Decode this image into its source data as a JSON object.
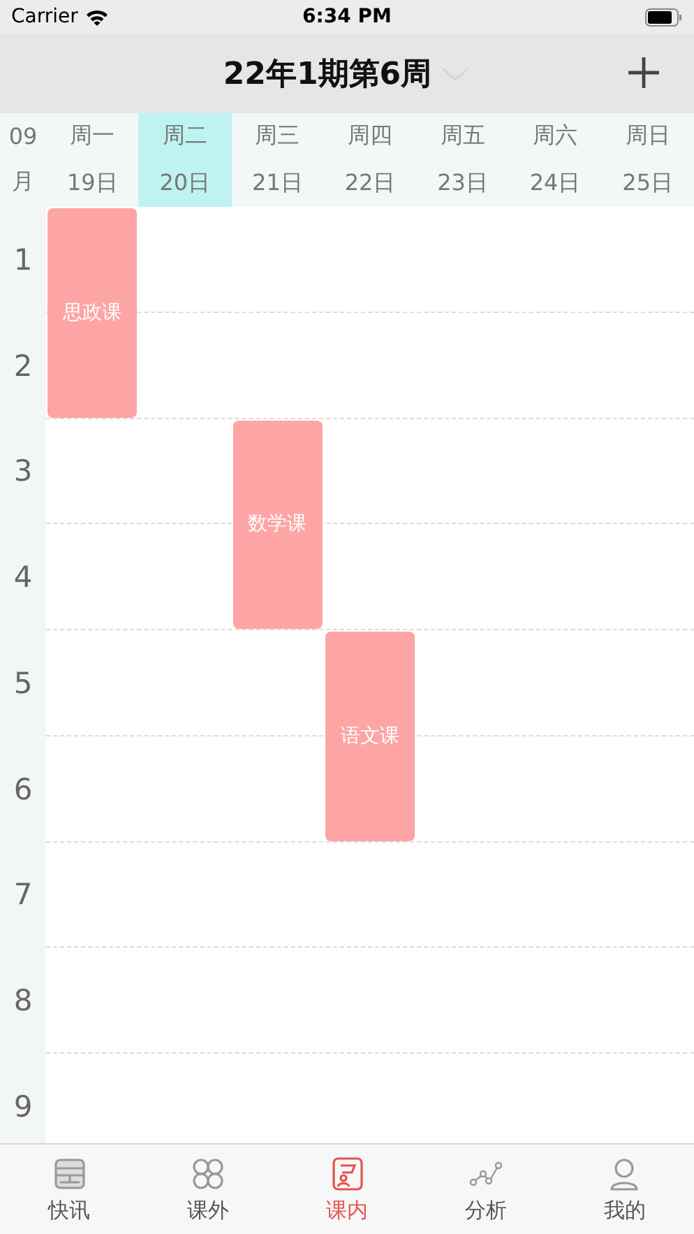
{
  "status_bar": {
    "carrier": "Carrier",
    "time": "6:34 PM"
  },
  "header": {
    "title": "22年1期第6周",
    "dropdown": true
  },
  "month": {
    "number": "09",
    "unit": "月"
  },
  "days": [
    {
      "weekday": "周一",
      "date": "19日",
      "selected": false,
      "sessions": [
        {
          "kind": "course",
          "name": "思政课"
        }
      ]
    },
    {
      "weekday": "周二",
      "date": "20日",
      "selected": true
    },
    {
      "weekday": "周三",
      "date": "21日",
      "selected": false,
      "sessions": [
        {
          "kind": "gap"
        },
        {
          "kind": "gap"
        },
        {
          "kind": "course",
          "name": "数学课"
        }
      ]
    },
    {
      "weekday": "周四",
      "date": "22日",
      "selected": false,
      "sessions": [
        {
          "kind": "gap"
        },
        {
          "kind": "gap"
        },
        {
          "kind": "gap"
        },
        {
          "kind": "gap"
        },
        {
          "kind": "course",
          "name": "语文课"
        }
      ]
    },
    {
      "weekday": "周五",
      "date": "23日",
      "selected": false
    },
    {
      "weekday": "周六",
      "date": "24日",
      "selected": false
    },
    {
      "weekday": "周日",
      "date": "25日",
      "selected": false
    }
  ],
  "periods": [
    "1",
    "2",
    "3",
    "4",
    "5",
    "6",
    "7",
    "8",
    "9"
  ],
  "tab_bar": [
    {
      "kind": "news",
      "label": "快讯",
      "selected": false
    },
    {
      "kind": "extra",
      "label": "课外",
      "selected": false
    },
    {
      "kind": "class",
      "label": "课内",
      "selected": true
    },
    {
      "kind": "analysis",
      "label": "分析",
      "selected": false
    },
    {
      "kind": "profile",
      "label": "我的",
      "selected": false
    }
  ]
}
